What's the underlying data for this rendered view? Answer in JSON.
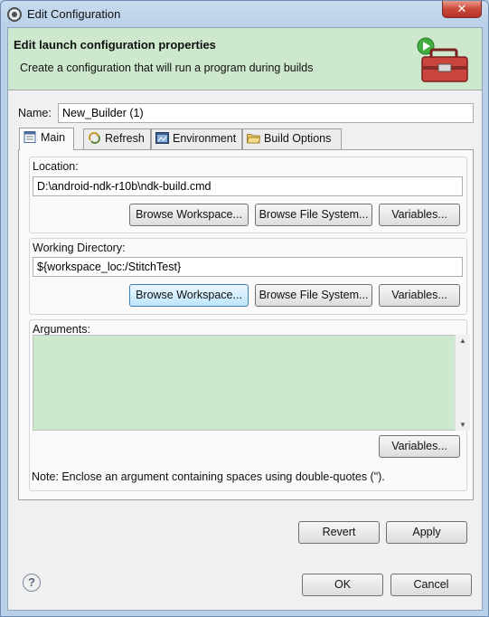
{
  "window": {
    "title": "Edit Configuration",
    "close_glyph": "✕"
  },
  "header": {
    "title": "Edit launch configuration properties",
    "description": "Create a configuration that will run a program during builds",
    "icon": "toolbox-run-icon"
  },
  "name": {
    "label": "Name:",
    "value": "New_Builder (1)"
  },
  "tabs": [
    {
      "label": "Main",
      "icon": "main-tab-icon",
      "active": true
    },
    {
      "label": "Refresh",
      "icon": "refresh-icon",
      "active": false
    },
    {
      "label": "Environment",
      "icon": "environment-icon",
      "active": false
    },
    {
      "label": "Build Options",
      "icon": "folder-icon",
      "active": false
    }
  ],
  "location": {
    "label": "Location:",
    "value": "D:\\android-ndk-r10b\\ndk-build.cmd",
    "browse_workspace": "Browse Workspace...",
    "browse_file_system": "Browse File System...",
    "variables": "Variables..."
  },
  "working_directory": {
    "label": "Working Directory:",
    "value": "${workspace_loc:/StitchTest}",
    "browse_workspace": "Browse Workspace...",
    "browse_file_system": "Browse File System...",
    "variables": "Variables..."
  },
  "arguments": {
    "label": "Arguments:",
    "value": "",
    "variables": "Variables...",
    "note": "Note: Enclose an argument containing spaces using double-quotes (\")."
  },
  "actions": {
    "revert": "Revert",
    "apply": "Apply"
  },
  "footer": {
    "help_glyph": "?",
    "ok": "OK",
    "cancel": "Cancel"
  },
  "colors": {
    "header_bg": "#cde8cd",
    "arguments_bg": "#cde8cd",
    "accent": "#3c7fb1"
  }
}
